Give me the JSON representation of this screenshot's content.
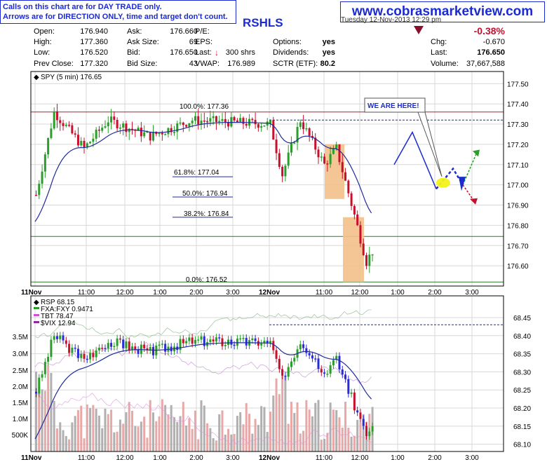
{
  "disclaimer": {
    "line1": "Calls on this chart are for DAY TRADE only.",
    "line2": "Arrows are for DIRECTION ONLY, time and target don't count."
  },
  "site_url": "www.cobrasmarketview.com",
  "symbol": "RSHLS",
  "header_timestamp": "Tuesday 12-Nov-2013 12:29 pm",
  "quote": {
    "open_label": "Open:",
    "open": "176.940",
    "high_label": "High:",
    "high": "177.360",
    "low_label": "Low:",
    "low": "176.520",
    "prev_close_label": "Prev Close:",
    "prev_close": "177.320",
    "ask_label": "Ask:",
    "ask": "176.660",
    "ask_size_label": "Ask Size:",
    "ask_size": "69",
    "bid_label": "Bid:",
    "bid": "176.650",
    "bid_size_label": "Bid Size:",
    "bid_size": "43",
    "pe_label": "P/E:",
    "pe": "",
    "eps_label": "EPS:",
    "eps": "",
    "last_label": "Last:",
    "last_shares": "300 shrs",
    "vwap_label": "VWAP:",
    "vwap": "176.989",
    "options_label": "Options:",
    "options": "yes",
    "dividends_label": "Dividends:",
    "dividends": "yes",
    "sctr_label": "SCTR (ETF):",
    "sctr": "80.2",
    "change_pct": "-0.38%",
    "chg_label": "Chg:",
    "chg": "-0.670",
    "last2_label": "Last:",
    "last": "176.650",
    "volume_label": "Volume:",
    "volume": "37,667,588"
  },
  "colors": {
    "brand_blue": "#1b2bd1",
    "up_bar": "#2a9d2a",
    "down_bar": "#c8102e",
    "ma_line": "#1f2a9c",
    "fib_band": "#f4c08a",
    "resistance_line": "#c8102e",
    "support_line": "#2a7d2a"
  },
  "chart_data": [
    {
      "type": "candlestick",
      "title": "SPY (5 min) 176.65",
      "x_ticks": [
        "11Nov",
        "11:00",
        "12:00",
        "1:00",
        "2:00",
        "3:00",
        "12Nov",
        "11:00",
        "12:00",
        "1:00",
        "2:00",
        "3:00"
      ],
      "ylim": [
        176.5,
        177.56
      ],
      "y_ticks": [
        "177.50",
        "177.40",
        "177.30",
        "177.20",
        "177.10",
        "177.00",
        "176.90",
        "176.80",
        "176.70",
        "176.60"
      ],
      "fib_levels": [
        {
          "label": "100.0%: 177.36",
          "value": 177.36
        },
        {
          "label": "61.8%: 177.04",
          "value": 177.04
        },
        {
          "label": "50.0%: 176.94",
          "value": 176.94
        },
        {
          "label": "38.2%: 176.84",
          "value": 176.84
        },
        {
          "label": "0.0%: 176.52",
          "value": 176.52
        }
      ],
      "horizontal_lines": {
        "resistance": 177.36,
        "prev_close_dashed": 177.32,
        "support": 176.745,
        "low": 176.52
      },
      "annotation": "WE ARE HERE!",
      "projection": [
        177.1,
        177.26,
        176.98,
        177.08,
        177.0
      ],
      "projection_branches": {
        "up_target": 177.16,
        "down_target": 176.92
      }
    },
    {
      "type": "line",
      "title": "RSP 68.15",
      "legend": [
        {
          "name": "FXA:FXY 0.9471",
          "color": "#2a9d2a"
        },
        {
          "name": "TBT 78.47",
          "color": "#d050d0"
        },
        {
          "name": "$VIX 12.94",
          "color": "#8e2a9e"
        }
      ],
      "ylim": [
        68.08,
        68.51
      ],
      "y_ticks": [
        "68.45",
        "68.40",
        "68.35",
        "68.30",
        "68.25",
        "68.20",
        "68.15",
        "68.10"
      ],
      "volume_ticks": [
        "3.5M",
        "3.0M",
        "2.5M",
        "2.0M",
        "1.5M",
        "1.0M",
        "500K"
      ],
      "dashed_level": 68.43
    }
  ]
}
